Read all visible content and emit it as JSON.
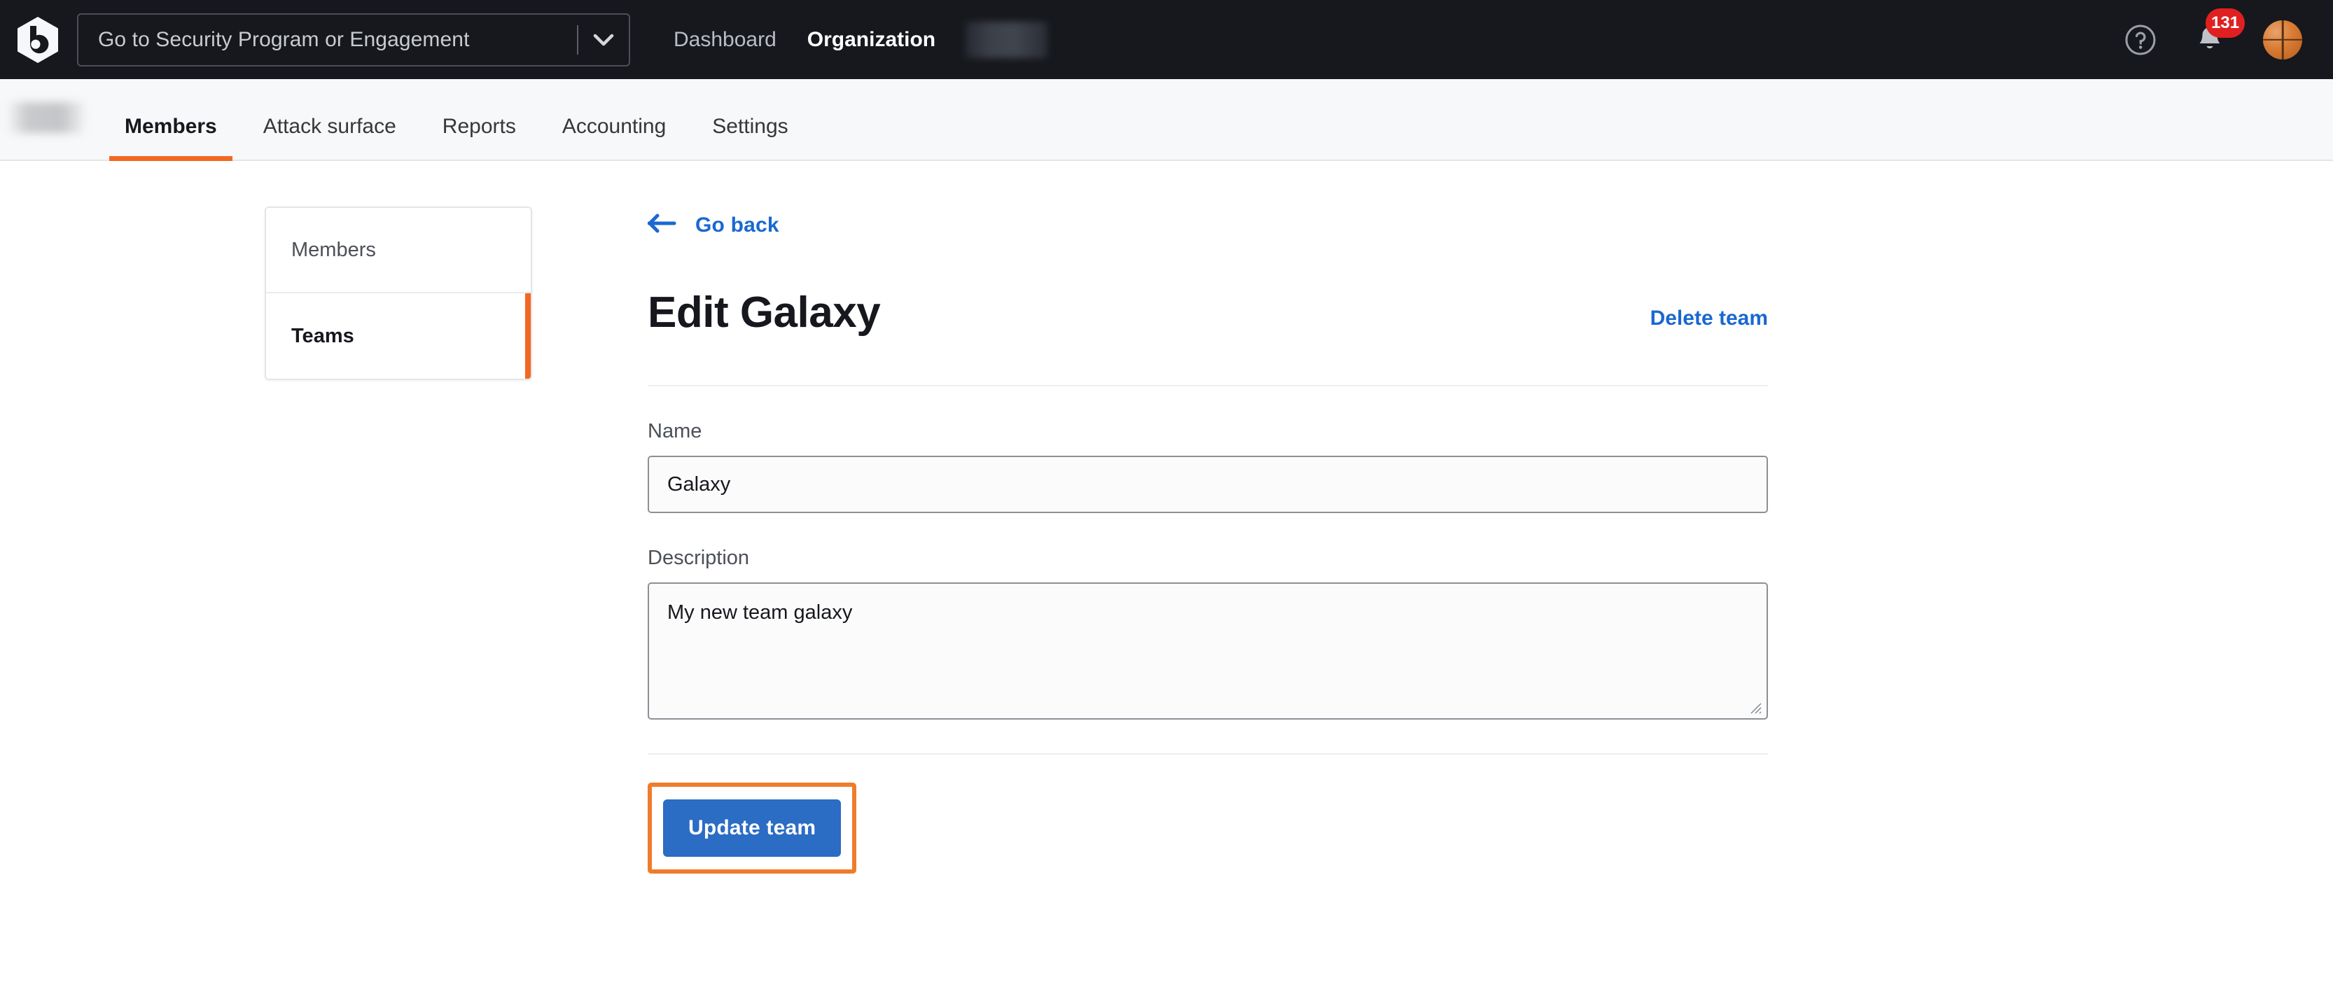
{
  "topbar": {
    "logo_name": "bugcrowd-logo",
    "program_select": {
      "placeholder": "Go to Security Program or Engagement",
      "value": "Go to Security Program or Engagement"
    },
    "nav": [
      {
        "label": "Dashboard",
        "active": false
      },
      {
        "label": "Organization",
        "active": true
      }
    ],
    "redacted_org_label": "",
    "help_icon": "question-circle-icon",
    "notifications": {
      "icon": "bell-icon",
      "badge_count": "131",
      "badge_color": "#e02020"
    },
    "avatar_icon": "basketball-avatar"
  },
  "tabbar": {
    "redacted_badge": "",
    "tabs": [
      {
        "label": "Members",
        "active": true
      },
      {
        "label": "Attack surface",
        "active": false
      },
      {
        "label": "Reports",
        "active": false
      },
      {
        "label": "Accounting",
        "active": false
      },
      {
        "label": "Settings",
        "active": false
      }
    ],
    "active_underline_color": "#f26822"
  },
  "sidebar": {
    "items": [
      {
        "label": "Members",
        "active": false
      },
      {
        "label": "Teams",
        "active": true
      }
    ],
    "active_marker_color": "#f26822"
  },
  "main": {
    "go_back": {
      "label": "Go back",
      "icon": "arrow-left-icon",
      "color": "#1a68d1"
    },
    "title": "Edit Galaxy",
    "delete_link": "Delete team",
    "fields": [
      {
        "label": "Name",
        "value": "Galaxy",
        "placeholder": "Name"
      },
      {
        "label": "Description",
        "value": "My new team galaxy",
        "placeholder": "Description"
      }
    ],
    "submit_button": {
      "label": "Update team",
      "color": "#2b6cc4",
      "highlight_color": "#f07c2b"
    }
  }
}
